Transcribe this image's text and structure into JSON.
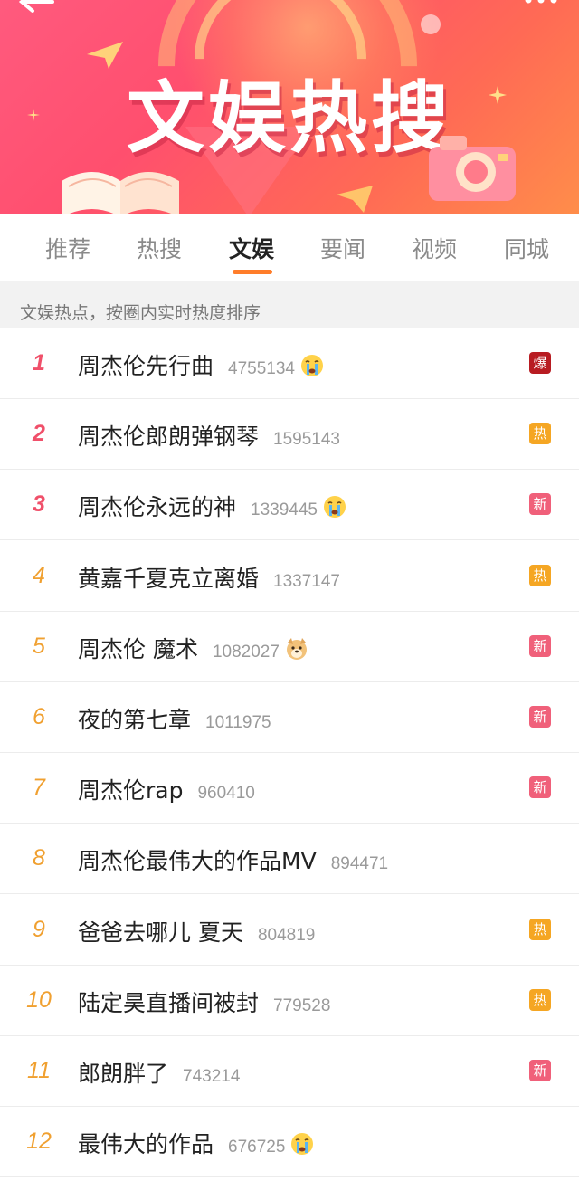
{
  "banner": {
    "title": "文娱热搜"
  },
  "tabs": [
    {
      "label": "推荐",
      "active": false
    },
    {
      "label": "热搜",
      "active": false
    },
    {
      "label": "文娱",
      "active": true
    },
    {
      "label": "要闻",
      "active": false
    },
    {
      "label": "视频",
      "active": false
    },
    {
      "label": "同城",
      "active": false
    }
  ],
  "subheader": "文娱热点，按圈内实时热度排序",
  "colors": {
    "accent": "#ff7d2a",
    "badge_bao": "#b81c22",
    "badge_re": "#f5a623",
    "badge_xin": "#f0607a",
    "rank_top": "#f0506a",
    "rank_other": "#f0a030"
  },
  "items": [
    {
      "rank": "1",
      "title": "周杰伦先行曲",
      "count": "4755134",
      "emoji": "crying-face-icon",
      "badge": "爆",
      "badge_type": "bao"
    },
    {
      "rank": "2",
      "title": "周杰伦郎朗弹钢琴",
      "count": "1595143",
      "emoji": "",
      "badge": "热",
      "badge_type": "re"
    },
    {
      "rank": "3",
      "title": "周杰伦永远的神",
      "count": "1339445",
      "emoji": "crying-face-icon",
      "badge": "新",
      "badge_type": "xin"
    },
    {
      "rank": "4",
      "title": "黄嘉千夏克立离婚",
      "count": "1337147",
      "emoji": "",
      "badge": "热",
      "badge_type": "re"
    },
    {
      "rank": "5",
      "title": "周杰伦 魔术",
      "count": "1082027",
      "emoji": "doge-icon",
      "badge": "新",
      "badge_type": "xin"
    },
    {
      "rank": "6",
      "title": "夜的第七章",
      "count": "1011975",
      "emoji": "",
      "badge": "新",
      "badge_type": "xin"
    },
    {
      "rank": "7",
      "title": "周杰伦rap",
      "count": "960410",
      "emoji": "",
      "badge": "新",
      "badge_type": "xin"
    },
    {
      "rank": "8",
      "title": "周杰伦最伟大的作品MV",
      "count": "894471",
      "emoji": "",
      "badge": "",
      "badge_type": ""
    },
    {
      "rank": "9",
      "title": "爸爸去哪儿 夏天",
      "count": "804819",
      "emoji": "",
      "badge": "热",
      "badge_type": "re"
    },
    {
      "rank": "10",
      "title": "陆定昊直播间被封",
      "count": "779528",
      "emoji": "",
      "badge": "热",
      "badge_type": "re"
    },
    {
      "rank": "11",
      "title": "郎朗胖了",
      "count": "743214",
      "emoji": "",
      "badge": "新",
      "badge_type": "xin"
    },
    {
      "rank": "12",
      "title": "最伟大的作品",
      "count": "676725",
      "emoji": "crying-face-icon",
      "badge": "",
      "badge_type": ""
    }
  ]
}
